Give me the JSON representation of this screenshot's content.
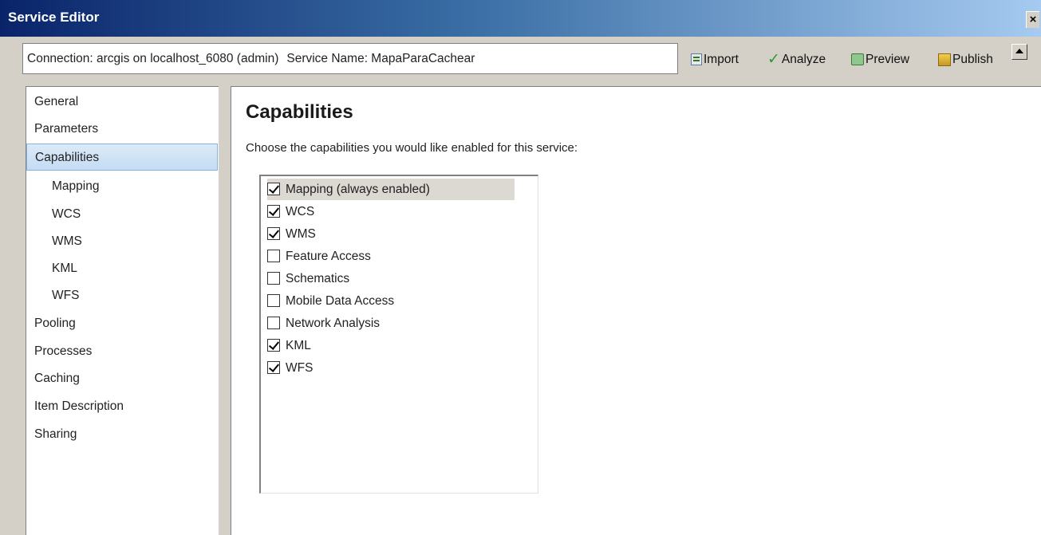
{
  "window": {
    "title": "Service Editor"
  },
  "toolbar": {
    "connection_text": "Connection: arcgis on localhost_6080 (admin)",
    "service_text": "Service Name: MapaParaCachear",
    "import_label": "Import",
    "analyze_label": "Analyze",
    "preview_label": "Preview",
    "publish_label": "Publish"
  },
  "sidebar": {
    "items": [
      {
        "label": "General",
        "sub": false
      },
      {
        "label": "Parameters",
        "sub": false
      },
      {
        "label": "Capabilities",
        "sub": false,
        "selected": true
      },
      {
        "label": "Mapping",
        "sub": true
      },
      {
        "label": "WCS",
        "sub": true
      },
      {
        "label": "WMS",
        "sub": true
      },
      {
        "label": "KML",
        "sub": true
      },
      {
        "label": "WFS",
        "sub": true
      },
      {
        "label": "Pooling",
        "sub": false
      },
      {
        "label": "Processes",
        "sub": false
      },
      {
        "label": "Caching",
        "sub": false
      },
      {
        "label": "Item Description",
        "sub": false
      },
      {
        "label": "Sharing",
        "sub": false
      }
    ]
  },
  "main": {
    "title": "Capabilities",
    "description": "Choose the capabilities you would like enabled for this service:",
    "capabilities": [
      {
        "label": "Mapping (always enabled)",
        "checked": true
      },
      {
        "label": "WCS",
        "checked": true
      },
      {
        "label": "WMS",
        "checked": true
      },
      {
        "label": "Feature Access",
        "checked": false
      },
      {
        "label": "Schematics",
        "checked": false
      },
      {
        "label": "Mobile Data Access",
        "checked": false
      },
      {
        "label": "Network Analysis",
        "checked": false
      },
      {
        "label": "KML",
        "checked": true
      },
      {
        "label": "WFS",
        "checked": true
      }
    ]
  }
}
